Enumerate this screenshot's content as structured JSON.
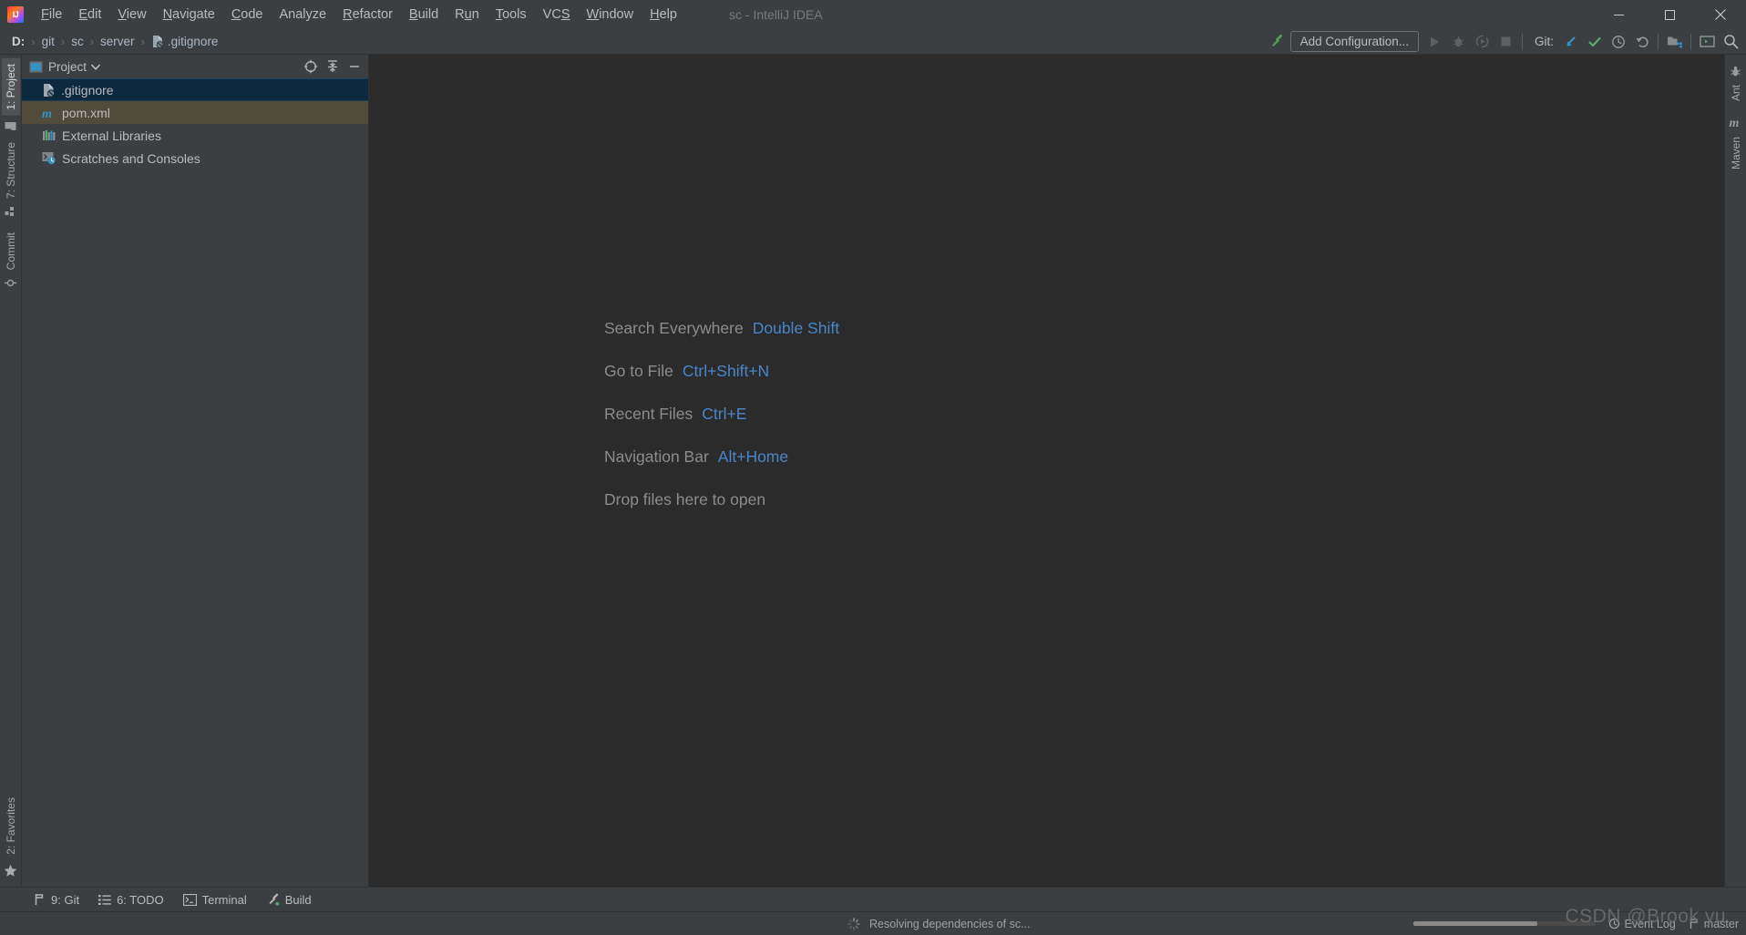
{
  "window": {
    "title": "sc - IntelliJ IDEA",
    "logo_icon": "intellij-idea-logo",
    "minimize_icon": "minimize-icon",
    "maximize_icon": "maximize-icon",
    "close_icon": "close-icon"
  },
  "menu": {
    "items": [
      {
        "label": "File",
        "mnemonic": "F"
      },
      {
        "label": "Edit",
        "mnemonic": "E"
      },
      {
        "label": "View",
        "mnemonic": "V"
      },
      {
        "label": "Navigate",
        "mnemonic": "N"
      },
      {
        "label": "Code",
        "mnemonic": "C"
      },
      {
        "label": "Analyze",
        "mnemonic": ""
      },
      {
        "label": "Refactor",
        "mnemonic": "R"
      },
      {
        "label": "Build",
        "mnemonic": "B"
      },
      {
        "label": "Run",
        "mnemonic": "u"
      },
      {
        "label": "Tools",
        "mnemonic": "T"
      },
      {
        "label": "VCS",
        "mnemonic": "S"
      },
      {
        "label": "Window",
        "mnemonic": "W"
      },
      {
        "label": "Help",
        "mnemonic": "H"
      }
    ]
  },
  "navbar": {
    "crumbs": [
      {
        "label": "D:",
        "icon": ""
      },
      {
        "label": "git",
        "icon": ""
      },
      {
        "label": "sc",
        "icon": ""
      },
      {
        "label": "server",
        "icon": ""
      },
      {
        "label": ".gitignore",
        "icon": "gitignore-file-icon"
      }
    ],
    "separator": "›"
  },
  "toolbar": {
    "build_icon": "hammer-build-icon",
    "add_configuration_label": "Add Configuration...",
    "run_icon": "run-icon",
    "debug_icon": "debug-icon",
    "run_with_coverage_icon": "run-with-coverage-icon",
    "stop_icon": "stop-icon",
    "git_label": "Git:",
    "git_update_icon": "update-project-icon",
    "git_commit_icon": "commit-checkmark-icon",
    "git_history_icon": "history-clock-icon",
    "git_rollback_icon": "rollback-undo-icon",
    "project_structure_icon": "project-structure-icon",
    "terminal_icon": "terminal-window-icon",
    "search_icon": "search-icon"
  },
  "left_rail": {
    "top_items": [
      {
        "label": "1: Project",
        "mnemonic": "1",
        "icon": "project-icon",
        "active": true
      },
      {
        "label": "",
        "mnemonic": "",
        "icon": "folder-icon",
        "active": false
      },
      {
        "label": "7: Structure",
        "mnemonic": "7",
        "icon": "structure-icon",
        "active": false
      },
      {
        "label": "Commit",
        "mnemonic": "",
        "icon": "commit-icon",
        "active": false
      }
    ],
    "bottom_items": [
      {
        "label": "2: Favorites",
        "mnemonic": "2",
        "icon": "favorites-star-icon",
        "active": false
      }
    ]
  },
  "right_rail": {
    "items": [
      {
        "label": "Ant",
        "icon": "ant-icon"
      },
      {
        "label": "Maven",
        "icon": "maven-m-icon"
      }
    ]
  },
  "project_panel": {
    "title": "Project",
    "window_icon": "project-window-icon",
    "dropdown_icon": "chevron-down-icon",
    "locate_icon": "scroll-from-source-icon",
    "collapse_icon": "collapse-all-icon",
    "hide_icon": "hide-panel-icon",
    "tree": [
      {
        "label": ".gitignore",
        "icon": "gitignore-file-icon",
        "state": "selected"
      },
      {
        "label": "pom.xml",
        "icon": "maven-pom-icon",
        "state": "modified"
      },
      {
        "label": "External Libraries",
        "icon": "external-libraries-icon",
        "state": "normal"
      },
      {
        "label": "Scratches and Consoles",
        "icon": "scratches-consoles-icon",
        "state": "normal"
      }
    ]
  },
  "editor": {
    "hints": [
      {
        "label": "Search Everywhere",
        "key": "Double Shift"
      },
      {
        "label": "Go to File",
        "key": "Ctrl+Shift+N"
      },
      {
        "label": "Recent Files",
        "key": "Ctrl+E"
      },
      {
        "label": "Navigation Bar",
        "key": "Alt+Home"
      }
    ],
    "drop_text": "Drop files here to open"
  },
  "bottom_bar": {
    "items": [
      {
        "label": "9: Git",
        "mnemonic": "9",
        "icon": "git-branch-icon"
      },
      {
        "label": "6: TODO",
        "mnemonic": "6",
        "icon": "todo-list-icon"
      },
      {
        "label": "Terminal",
        "mnemonic": "",
        "icon": "terminal-icon"
      },
      {
        "label": "Build",
        "mnemonic": "",
        "icon": "build-hammer-icon"
      }
    ]
  },
  "status_bar": {
    "progress_text": "Resolving dependencies of sc...",
    "progress_icon": "loading-spinner-icon",
    "progress_percent": 68,
    "event_log_label": "Event Log",
    "event_log_icon": "event-log-icon",
    "branch_label": "master",
    "branch_icon": "git-branch-icon",
    "stop_progress_icon": "cancel-progress-icon"
  },
  "watermark": {
    "text": "CSDN @Brook yu"
  },
  "colors": {
    "background": "#3c3f41",
    "editor_background": "#2b2b2b",
    "accent_blue": "#4a86c8",
    "selection": "#0d293e",
    "modified": "#514b3c",
    "green": "#5a9e4b",
    "text": "#bbbbbb"
  }
}
